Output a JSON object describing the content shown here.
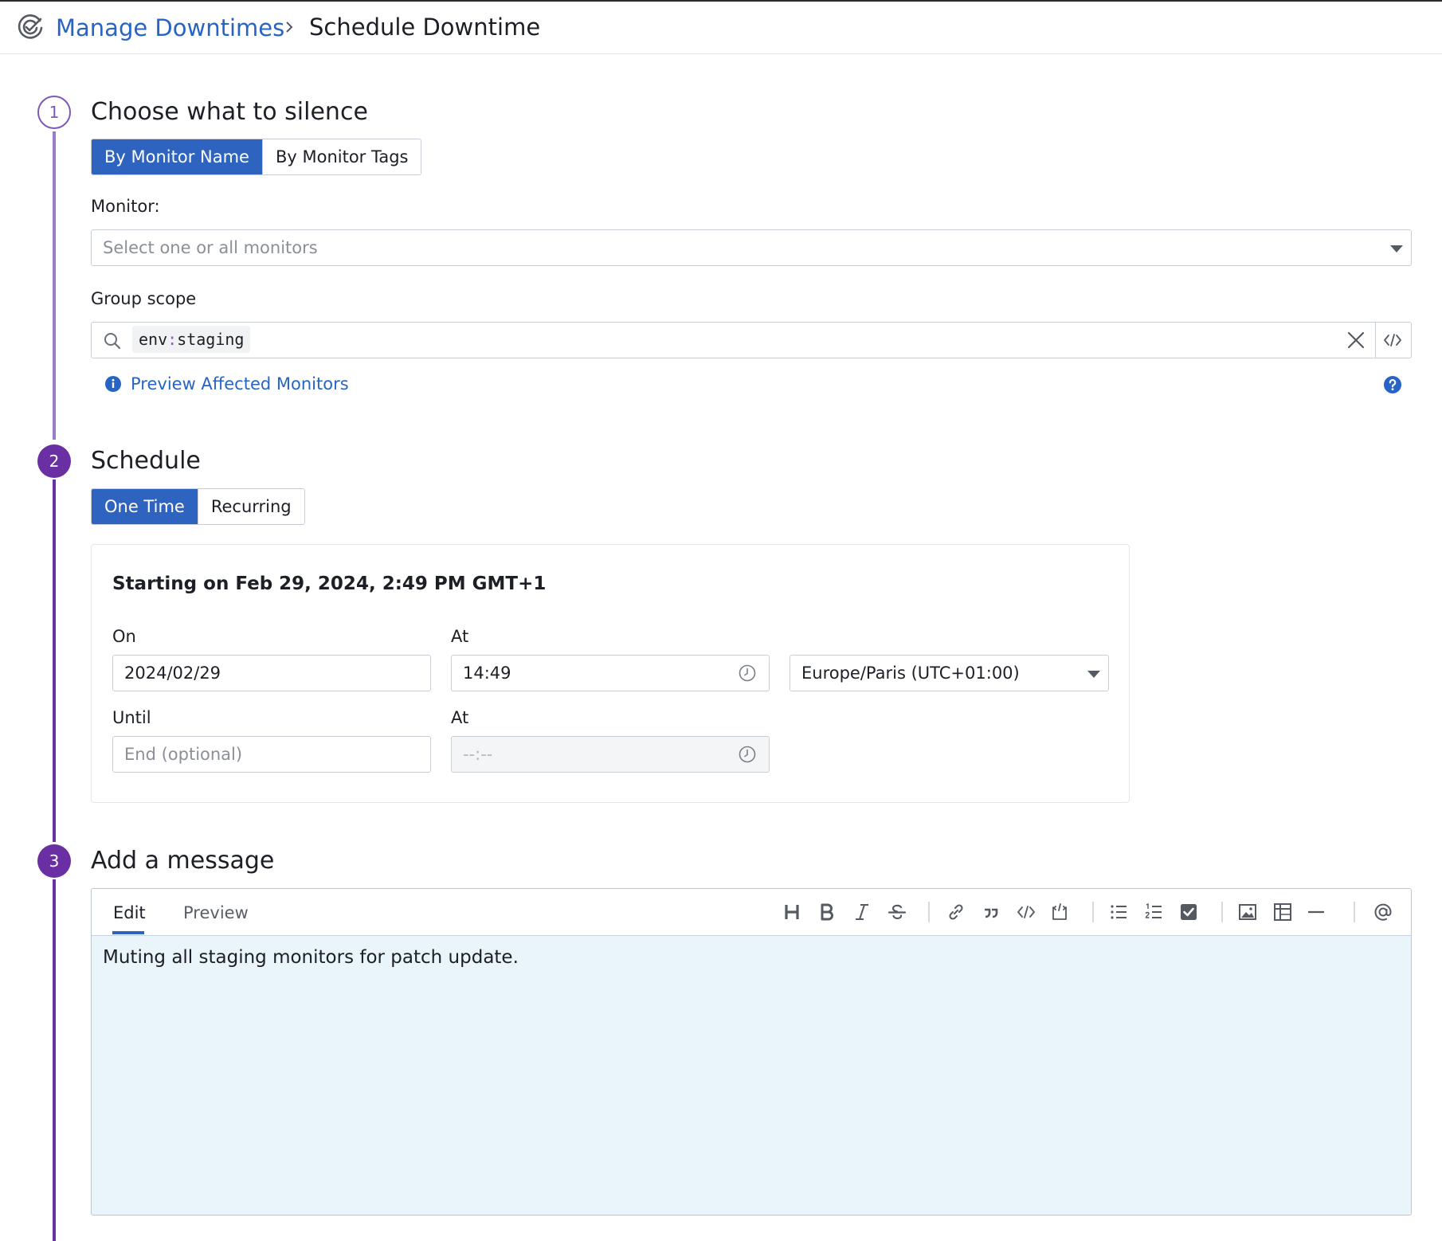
{
  "breadcrumb": {
    "parent": "Manage Downtimes",
    "current": "Schedule Downtime"
  },
  "steps": [
    {
      "number": "1",
      "title": "Choose what to silence"
    },
    {
      "number": "2",
      "title": "Schedule"
    },
    {
      "number": "3",
      "title": "Add a message"
    }
  ],
  "silence": {
    "mode_options": [
      "By Monitor Name",
      "By Monitor Tags"
    ],
    "selected_mode": "By Monitor Name",
    "monitor_label": "Monitor:",
    "monitor_placeholder": "Select one or all monitors",
    "group_scope_label": "Group scope",
    "group_scope_tag_key": "env",
    "group_scope_tag_sep": ":",
    "group_scope_tag_value": "staging",
    "preview_link": "Preview Affected Monitors"
  },
  "schedule": {
    "type_options": [
      "One Time",
      "Recurring"
    ],
    "selected_type": "One Time",
    "summary": "Starting on Feb 29, 2024, 2:49 PM GMT+1",
    "on_label": "On",
    "on_value": "2024/02/29",
    "start_at_label": "At",
    "start_time": "14:49",
    "timezone": "Europe/Paris (UTC+01:00)",
    "until_label": "Until",
    "until_placeholder": "End (optional)",
    "end_at_label": "At",
    "end_time_placeholder": "--:--"
  },
  "message": {
    "tabs": [
      "Edit",
      "Preview"
    ],
    "active_tab": "Edit",
    "text": "Muting all staging monitors for patch update.",
    "toolbar_icons": [
      "heading-icon",
      "bold-icon",
      "italic-icon",
      "strikethrough-icon",
      "link-icon",
      "quote-icon",
      "code-icon",
      "code-block-icon",
      "bullet-list-icon",
      "numbered-list-icon",
      "checkbox-icon",
      "image-icon",
      "table-icon",
      "horizontal-rule-icon",
      "mention-icon"
    ]
  },
  "colors": {
    "accent_blue": "#2e64c0",
    "link_blue": "#2864c4",
    "step_purple": "#6a2fa2",
    "editor_background": "#eaf4fb"
  }
}
